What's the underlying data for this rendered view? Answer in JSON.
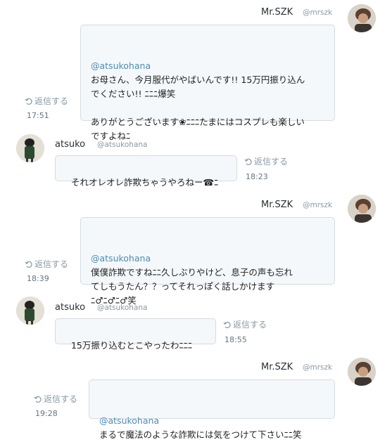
{
  "reply_label": "返信する",
  "messages": [
    {
      "sender_name": "Mr.SZK",
      "sender_handle": "@mrszk",
      "mention": "@atsukohana",
      "text": "お母さん、今月服代がやばいんです!! 15万円振り込ん\nでください!! ﾆﾆﾆ爆笑\n\nありがとうございます❀ﾆﾆﾆたまにはコスプレも楽しい\nですよねﾆ",
      "time": "17:51"
    },
    {
      "sender_name": "atsuko",
      "sender_handle": "@atsukohana",
      "text": "それオレオレ詐欺ちゃうやろねー☎ﾆ",
      "time": "18:23"
    },
    {
      "sender_name": "Mr.SZK",
      "sender_handle": "@mrszk",
      "mention": "@atsukohana",
      "text": "僕僕詐欺ですねﾆﾆ久しぶりやけど、息子の声も忘れ\nてしもうたん？？ってそれっぽく話しかけます\nﾆ♂ﾆ♂ﾆ♂笑",
      "time": "18:39"
    },
    {
      "sender_name": "atsuko",
      "sender_handle": "@atsukohana",
      "text": "15万振り込むとこやったわﾆﾆﾆ",
      "time": "18:55"
    },
    {
      "sender_name": "Mr.SZK",
      "sender_handle": "@mrszk",
      "mention": "@atsukohana",
      "text": "まるで魔法のような詐欺には気をつけて下さいﾆﾆ笑",
      "time": "19:28"
    }
  ]
}
